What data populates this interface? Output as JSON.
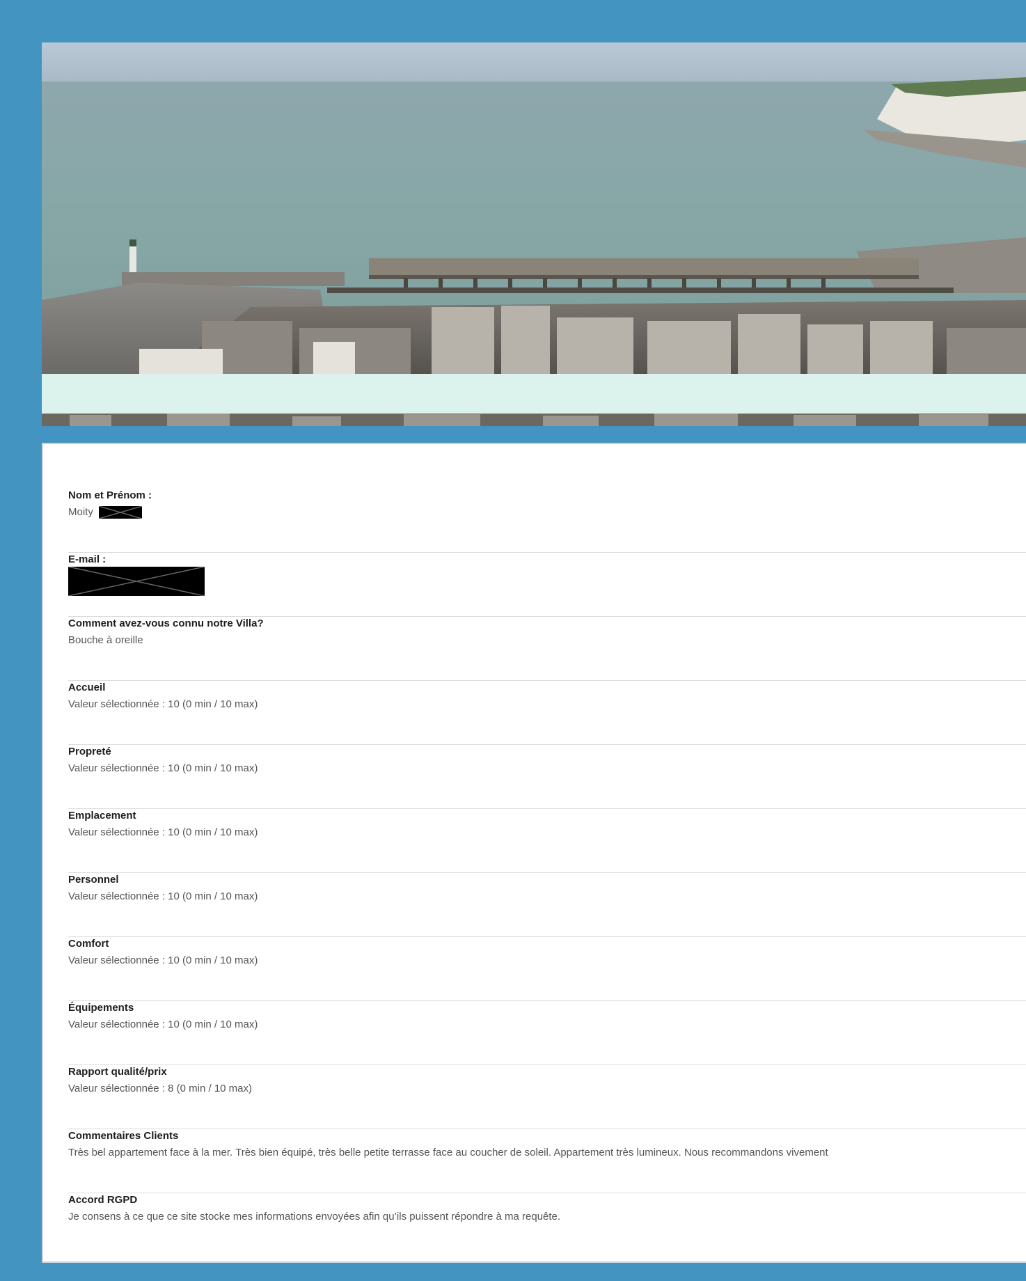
{
  "form": {
    "fields": [
      {
        "label": "Nom et Prénom :",
        "value": "Moity",
        "redacted": true
      },
      {
        "label": "E-mail :",
        "value": "",
        "redacted": true
      },
      {
        "label": "Comment avez-vous connu notre Villa?",
        "value": "Bouche à oreille"
      },
      {
        "label": "Accueil",
        "value": "Valeur sélectionnée : 10 (0 min / 10 max)"
      },
      {
        "label": "Propreté",
        "value": "Valeur sélectionnée : 10 (0 min / 10 max)"
      },
      {
        "label": "Emplacement",
        "value": "Valeur sélectionnée : 10 (0 min / 10 max)"
      },
      {
        "label": "Personnel",
        "value": "Valeur sélectionnée : 10 (0 min / 10 max)"
      },
      {
        "label": "Comfort",
        "value": "Valeur sélectionnée : 10 (0 min / 10 max)"
      },
      {
        "label": "Équipements",
        "value": "Valeur sélectionnée : 10 (0 min / 10 max)"
      },
      {
        "label": "Rapport qualité/prix",
        "value": "Valeur sélectionnée : 8 (0 min / 10 max)"
      },
      {
        "label": "Commentaires Clients",
        "value": "Très bel appartement face à la mer. Très bien équipé, très belle petite terrasse face au coucher de soleil. Appartement très lumineux. Nous recommandons vivement"
      },
      {
        "label": "Accord RGPD",
        "value": "Je consens à ce que ce site stocke mes informations envoyées afin qu’ils puissent répondre à ma requête."
      }
    ]
  },
  "colors": {
    "page_background": "#4394c1",
    "header_band": "#dcf2ec",
    "panel_background": "#ffffff",
    "label_text": "#1e1e1e",
    "value_text": "#555555"
  }
}
